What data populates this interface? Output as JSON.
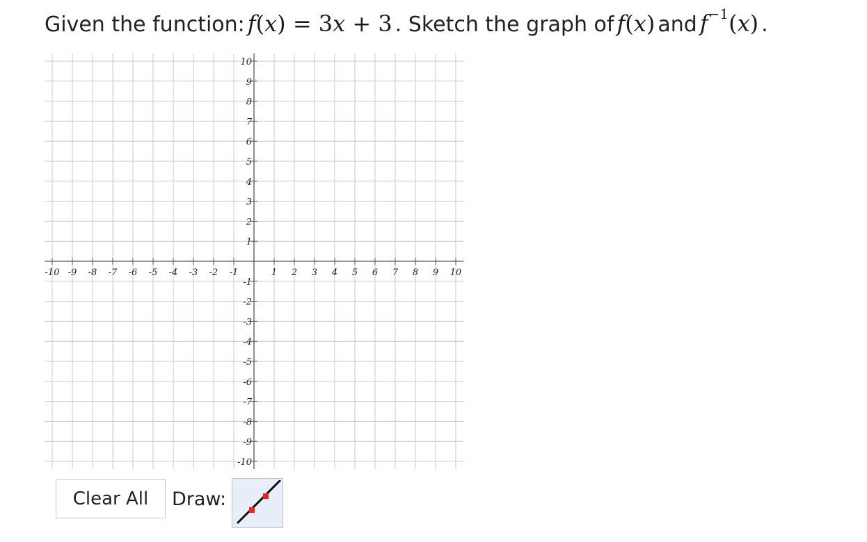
{
  "question": {
    "prefix": "Given the function:",
    "f_name": "f",
    "var": "x",
    "equals": "=",
    "rhs_coef": "3",
    "rhs_plus": "+",
    "rhs_const": "3",
    "middle": ". Sketch the graph of",
    "and": "and",
    "inverse_sup": "−1",
    "end": "."
  },
  "graph": {
    "x_range": [
      -10,
      10
    ],
    "y_range": [
      -10,
      10
    ],
    "x_tick_labels": [
      "-10",
      "-9",
      "-8",
      "-7",
      "-6",
      "-5",
      "-4",
      "-3",
      "-2",
      "-1",
      "1",
      "2",
      "3",
      "4",
      "5",
      "6",
      "7",
      "8",
      "9",
      "10"
    ],
    "y_tick_labels": [
      "10",
      "9",
      "8",
      "7",
      "6",
      "5",
      "4",
      "3",
      "2",
      "1",
      "-1",
      "-2",
      "-3",
      "-4",
      "-5",
      "-6",
      "-7",
      "-8",
      "-9",
      "-10"
    ],
    "grid": true
  },
  "controls": {
    "clear_label": "Clear All",
    "draw_label": "Draw:",
    "tool_icon": "line-tool-icon"
  },
  "colors": {
    "grid": "#c8c8c8",
    "axis": "#555555",
    "tool_point": "#ee2222",
    "tool_bg": "#e8eef7"
  }
}
